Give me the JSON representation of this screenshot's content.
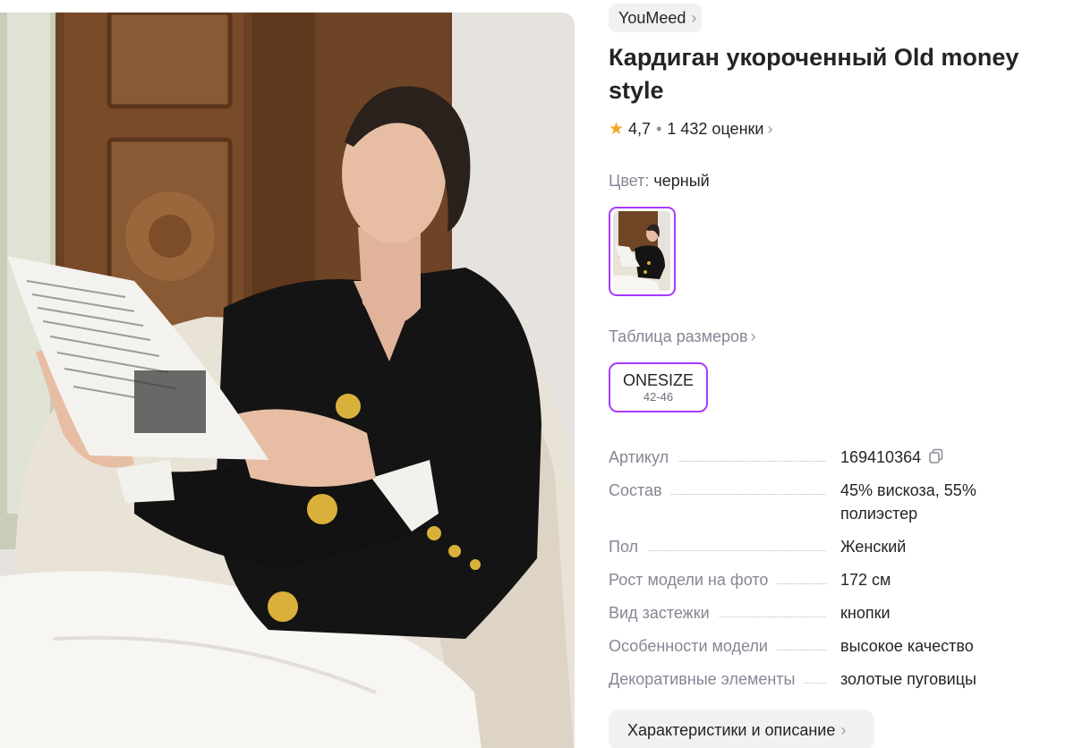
{
  "product": {
    "brand": "YouMeed",
    "title": "Кардиган укороченный Old money style",
    "rating": "4,7",
    "reviews": "1 432 оценки",
    "color_label": "Цвет:",
    "color_value": "черный",
    "size_table_label": "Таблица размеров",
    "size": {
      "name": "ONESIZE",
      "range": "42-46"
    },
    "specs": [
      {
        "key": "Артикул",
        "value": "169410364"
      },
      {
        "key": "Состав",
        "value": "45% вискоза, 55% полиэстер"
      },
      {
        "key": "Пол",
        "value": "Женский"
      },
      {
        "key": "Рост модели на фото",
        "value": "172 см"
      },
      {
        "key": "Вид застежки",
        "value": "кнопки"
      },
      {
        "key": "Особенности модели",
        "value": "высокое качество"
      },
      {
        "key": "Декоративные элементы",
        "value": "золотые пуговицы"
      }
    ],
    "description_button": "Характеристики и описание"
  },
  "icons": {
    "brand_chevron": "chevron-right-icon",
    "star": "star-icon",
    "copy": "copy-icon"
  },
  "colors": {
    "accent": "#a73afd",
    "star": "#f5a623",
    "muted_text": "#868695",
    "chip_bg": "#f1f1f4"
  }
}
